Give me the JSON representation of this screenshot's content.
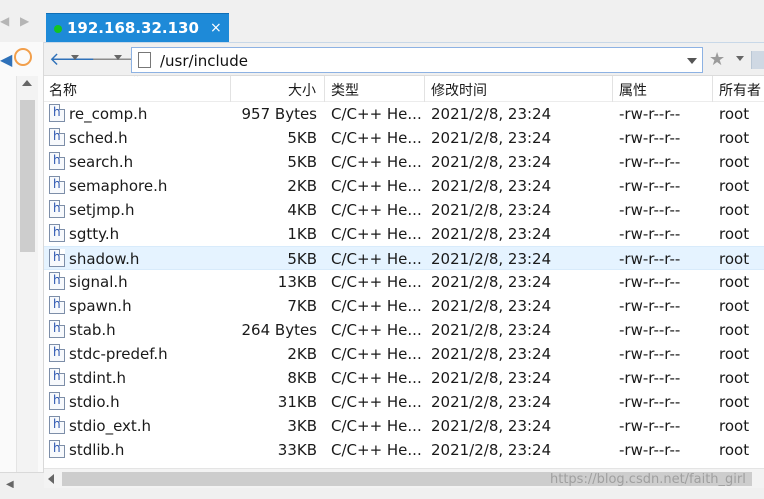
{
  "session_tab": {
    "title": "192.168.32.130",
    "close": "×"
  },
  "path": {
    "value": "/usr/include"
  },
  "columns": {
    "name": "名称",
    "size": "大小",
    "type": "类型",
    "modified": "修改时间",
    "attributes": "属性",
    "owner": "所有者"
  },
  "files": [
    {
      "name": "re_comp.h",
      "size": "957 Bytes",
      "type": "C/C++ He...",
      "modified": "2021/2/8, 23:24",
      "attributes": "-rw-r--r--",
      "owner": "root"
    },
    {
      "name": "sched.h",
      "size": "5KB",
      "type": "C/C++ He...",
      "modified": "2021/2/8, 23:24",
      "attributes": "-rw-r--r--",
      "owner": "root"
    },
    {
      "name": "search.h",
      "size": "5KB",
      "type": "C/C++ He...",
      "modified": "2021/2/8, 23:24",
      "attributes": "-rw-r--r--",
      "owner": "root"
    },
    {
      "name": "semaphore.h",
      "size": "2KB",
      "type": "C/C++ He...",
      "modified": "2021/2/8, 23:24",
      "attributes": "-rw-r--r--",
      "owner": "root"
    },
    {
      "name": "setjmp.h",
      "size": "4KB",
      "type": "C/C++ He...",
      "modified": "2021/2/8, 23:24",
      "attributes": "-rw-r--r--",
      "owner": "root"
    },
    {
      "name": "sgtty.h",
      "size": "1KB",
      "type": "C/C++ He...",
      "modified": "2021/2/8, 23:24",
      "attributes": "-rw-r--r--",
      "owner": "root"
    },
    {
      "name": "shadow.h",
      "size": "5KB",
      "type": "C/C++ He...",
      "modified": "2021/2/8, 23:24",
      "attributes": "-rw-r--r--",
      "owner": "root",
      "selected": true
    },
    {
      "name": "signal.h",
      "size": "13KB",
      "type": "C/C++ He...",
      "modified": "2021/2/8, 23:24",
      "attributes": "-rw-r--r--",
      "owner": "root"
    },
    {
      "name": "spawn.h",
      "size": "7KB",
      "type": "C/C++ He...",
      "modified": "2021/2/8, 23:24",
      "attributes": "-rw-r--r--",
      "owner": "root"
    },
    {
      "name": "stab.h",
      "size": "264 Bytes",
      "type": "C/C++ He...",
      "modified": "2021/2/8, 23:24",
      "attributes": "-rw-r--r--",
      "owner": "root"
    },
    {
      "name": "stdc-predef.h",
      "size": "2KB",
      "type": "C/C++ He...",
      "modified": "2021/2/8, 23:24",
      "attributes": "-rw-r--r--",
      "owner": "root"
    },
    {
      "name": "stdint.h",
      "size": "8KB",
      "type": "C/C++ He...",
      "modified": "2021/2/8, 23:24",
      "attributes": "-rw-r--r--",
      "owner": "root"
    },
    {
      "name": "stdio.h",
      "size": "31KB",
      "type": "C/C++ He...",
      "modified": "2021/2/8, 23:24",
      "attributes": "-rw-r--r--",
      "owner": "root"
    },
    {
      "name": "stdio_ext.h",
      "size": "3KB",
      "type": "C/C++ He...",
      "modified": "2021/2/8, 23:24",
      "attributes": "-rw-r--r--",
      "owner": "root"
    },
    {
      "name": "stdlib.h",
      "size": "33KB",
      "type": "C/C++ He...",
      "modified": "2021/2/8, 23:24",
      "attributes": "-rw-r--r--",
      "owner": "root"
    }
  ],
  "watermark": "https://blog.csdn.net/faith_girl",
  "colors": {
    "accent": "#1e8ad8",
    "connected": "#13c423",
    "selection": "#e5f3ff"
  }
}
